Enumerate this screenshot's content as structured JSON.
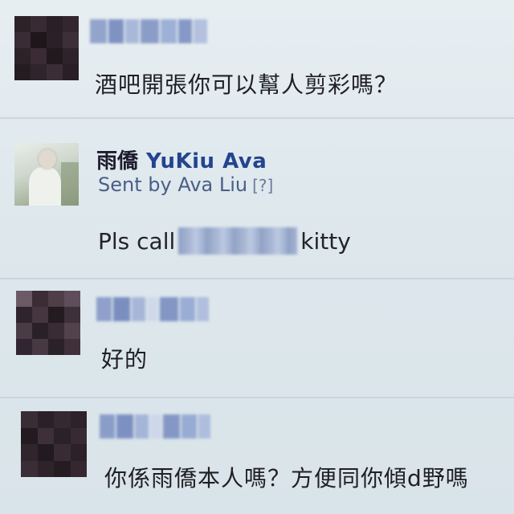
{
  "messages": [
    {
      "avatar": "pixelated-avatar",
      "sender_redacted": true,
      "text": "酒吧開張你可以幫人剪彩嗎？"
    },
    {
      "avatar": "photo-avatar",
      "sender_cjk": "雨僑",
      "sender_latin": "YuKiu Ava",
      "sent_by": "Sent by Ava Liu",
      "help_mark": "[?]",
      "text_before": "Pls call",
      "text_after": "kitty"
    },
    {
      "avatar": "pixelated-avatar",
      "sender_redacted": true,
      "text": "好的"
    },
    {
      "avatar": "pixelated-avatar",
      "sender_redacted": true,
      "text": "你係雨僑本人嗎？方便同你傾d野嗎"
    }
  ],
  "colors": {
    "background": "#dfe9ee",
    "sender_name_latin": "#23448f",
    "sent_by": "#4a5e86",
    "message_text": "#1f1f24"
  }
}
